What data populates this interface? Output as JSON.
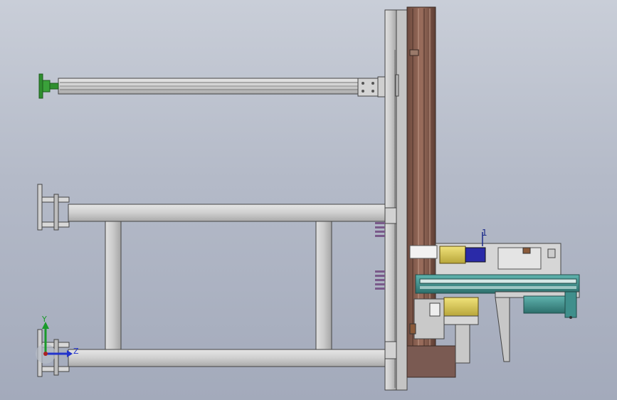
{
  "viewport": {
    "background_top": "#c9ced8",
    "background_bottom": "#a3aabb"
  },
  "triad": {
    "y_label": "Y",
    "z_label": "Z",
    "y_color": "#1a9a2a",
    "z_color": "#2233cc"
  },
  "callout": {
    "text": "1"
  },
  "colors": {
    "frame_grey": "#c8c8c8",
    "frame_edge": "#4a4a4a",
    "rail_brown": "#8a5a4a",
    "motor_teal": "#3f8f8c",
    "cylinder_yellow": "#d8c84a",
    "cylinder_blue": "#2a2aa8",
    "foot_green": "#2f8f2f",
    "base_brown": "#7a5a52"
  },
  "icons": {
    "triad": "coordinate-triad-icon"
  }
}
